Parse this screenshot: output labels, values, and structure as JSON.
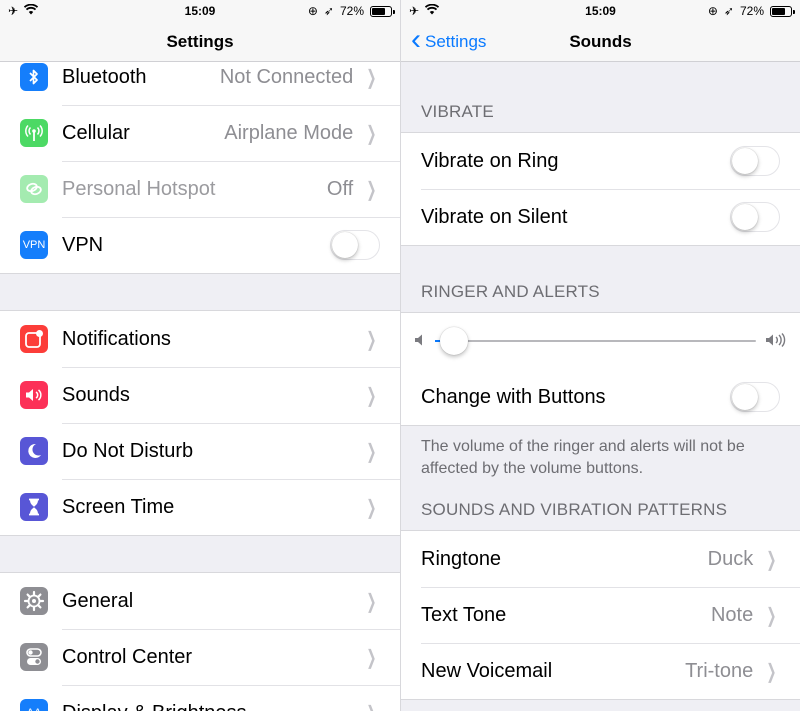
{
  "status": {
    "time": "15:09",
    "battery": "72%",
    "battery_level": 0.72
  },
  "left": {
    "title": "Settings",
    "group1": [
      {
        "name": "bluetooth",
        "label": "Bluetooth",
        "value": "Not Connected",
        "color": "#157efb",
        "icon": "bluetooth-icon"
      },
      {
        "name": "cellular",
        "label": "Cellular",
        "value": "Airplane Mode",
        "color": "#4cd964",
        "icon": "antenna-icon"
      },
      {
        "name": "personal-hotspot",
        "label": "Personal Hotspot",
        "value": "Off",
        "color": "#4cd964",
        "icon": "link-icon",
        "disabled": true
      },
      {
        "name": "vpn",
        "label": "VPN",
        "color": "#157efb",
        "icon": "vpn-icon",
        "icon_text": "VPN",
        "toggle": false
      }
    ],
    "group2": [
      {
        "name": "notifications",
        "label": "Notifications",
        "color": "#fc3d39",
        "icon": "notification-badge-icon"
      },
      {
        "name": "sounds",
        "label": "Sounds",
        "color": "#fc3158",
        "icon": "speaker-icon"
      },
      {
        "name": "do-not-disturb",
        "label": "Do Not Disturb",
        "color": "#5856d6",
        "icon": "moon-icon"
      },
      {
        "name": "screen-time",
        "label": "Screen Time",
        "color": "#5856d6",
        "icon": "hourglass-icon"
      }
    ],
    "group3": [
      {
        "name": "general",
        "label": "General",
        "color": "#8e8e93",
        "icon": "gear-icon"
      },
      {
        "name": "control-center",
        "label": "Control Center",
        "color": "#8e8e93",
        "icon": "switches-icon"
      },
      {
        "name": "display-brightness",
        "label": "Display & Brightness",
        "color": "#157efb",
        "icon": "text-size-icon",
        "icon_text": "AA"
      }
    ]
  },
  "right": {
    "back_label": "Settings",
    "title": "Sounds",
    "vibrate_header": "VIBRATE",
    "vibrate_ring": "Vibrate on Ring",
    "vibrate_silent": "Vibrate on Silent",
    "ringer_header": "RINGER AND ALERTS",
    "volume_level": 0.06,
    "change_with_buttons": "Change with Buttons",
    "footer": "The volume of the ringer and alerts will not be affected by the volume buttons.",
    "patterns_header": "SOUNDS AND VIBRATION PATTERNS",
    "ringtone_label": "Ringtone",
    "ringtone_value": "Duck",
    "text_tone_label": "Text Tone",
    "text_tone_value": "Note",
    "voicemail_label": "New Voicemail",
    "voicemail_value": "Tri-tone"
  }
}
